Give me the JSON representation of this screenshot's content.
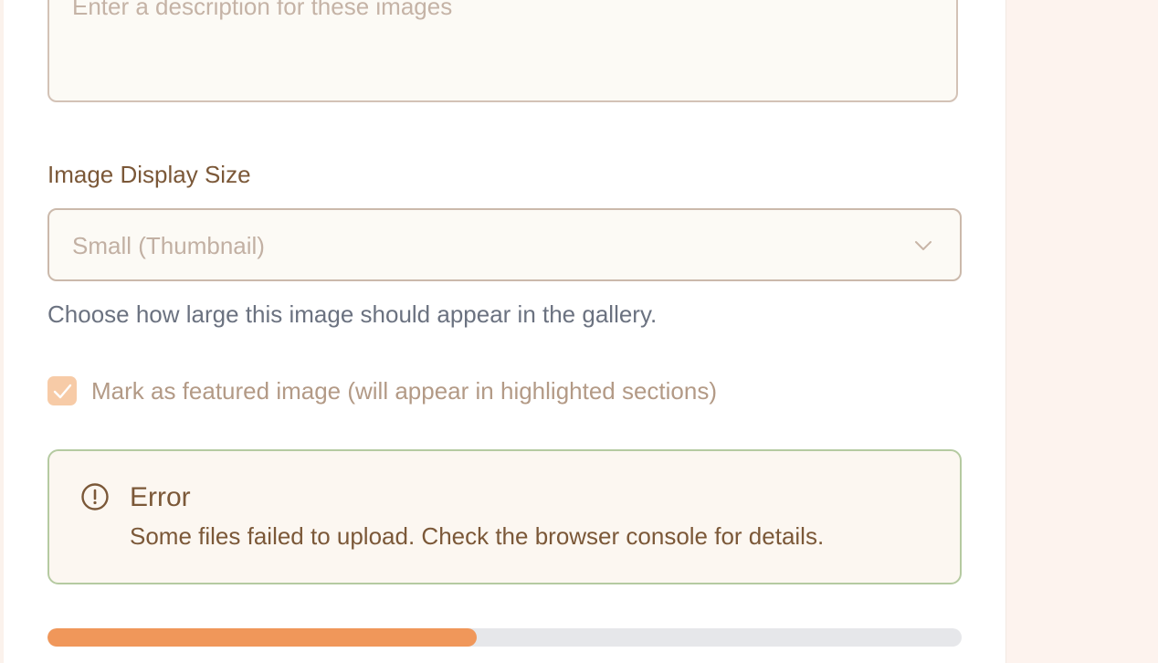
{
  "description_field": {
    "placeholder": "Enter a description for these images"
  },
  "display_size": {
    "label": "Image Display Size",
    "selected": "Small (Thumbnail)",
    "help_text": "Choose how large this image should appear in the gallery."
  },
  "featured": {
    "checked": true,
    "label": "Mark as featured image (will appear in highlighted sections)"
  },
  "alert": {
    "title": "Error",
    "message": "Some files failed to upload. Check the browser console for details.",
    "icon": "alert-circle-icon"
  },
  "upload_progress": {
    "fraction": 0.47
  },
  "colors": {
    "accent": "#f0975a",
    "label": "#7b5838",
    "alert_border": "#b5caa1",
    "checkbox": "#f7cba7"
  }
}
